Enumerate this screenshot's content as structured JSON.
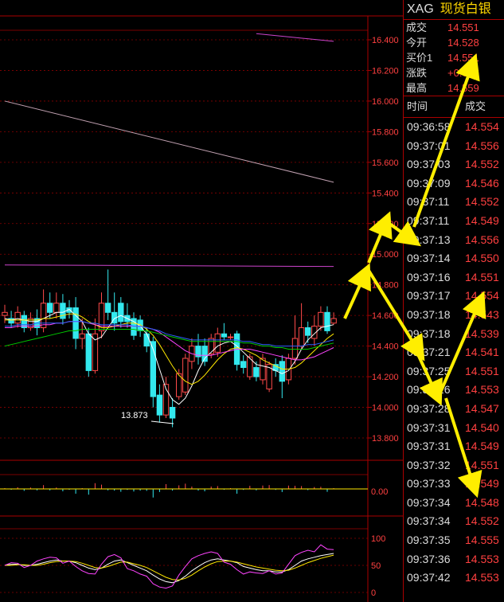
{
  "header": {
    "symbol": "XAG",
    "name": "现货白银"
  },
  "quote": [
    {
      "label": "成交",
      "value": "14.551"
    },
    {
      "label": "今开",
      "value": "14.528"
    },
    {
      "label": "买价1",
      "value": "14.551"
    },
    {
      "label": "涨跌",
      "value": "+0.086"
    },
    {
      "label": "最高",
      "value": "14.559"
    }
  ],
  "ticks_header": {
    "time": "时间",
    "price": "成交"
  },
  "ticks": [
    {
      "time": "09:36:58",
      "price": "14.554"
    },
    {
      "time": "09:37:01",
      "price": "14.556"
    },
    {
      "time": "09:37:03",
      "price": "14.552"
    },
    {
      "time": "09:37:09",
      "price": "14.546"
    },
    {
      "time": "09:37:11",
      "price": "14.552"
    },
    {
      "time": "09:37:11",
      "price": "14.549"
    },
    {
      "time": "09:37:13",
      "price": "14.556"
    },
    {
      "time": "09:37:14",
      "price": "14.550"
    },
    {
      "time": "09:37:16",
      "price": "14.551"
    },
    {
      "time": "09:37:17",
      "price": "14.554"
    },
    {
      "time": "09:37:18",
      "price": "14.543"
    },
    {
      "time": "09:37:18",
      "price": "14.539"
    },
    {
      "time": "09:37:21",
      "price": "14.541"
    },
    {
      "time": "09:37:25",
      "price": "14.551"
    },
    {
      "time": "09:37:26",
      "price": "14.553"
    },
    {
      "time": "09:37:28",
      "price": "14.547"
    },
    {
      "time": "09:37:31",
      "price": "14.540"
    },
    {
      "time": "09:37:31",
      "price": "14.549"
    },
    {
      "time": "09:37:32",
      "price": "14.551"
    },
    {
      "time": "09:37:33",
      "price": "14.549"
    },
    {
      "time": "09:37:34",
      "price": "14.548"
    },
    {
      "time": "09:37:34",
      "price": "14.552"
    },
    {
      "time": "09:37:35",
      "price": "14.555"
    },
    {
      "time": "09:37:36",
      "price": "14.553"
    },
    {
      "time": "09:37:42",
      "price": "14.553"
    }
  ],
  "chart_data": {
    "type": "candlestick",
    "price_axis": {
      "min": 13.8,
      "max": 16.4,
      "ticks": [
        "16.400",
        "16.200",
        "16.000",
        "15.800",
        "15.600",
        "15.400",
        "15.200",
        "15.000",
        "14.800",
        "14.600",
        "14.400",
        "14.200",
        "14.000",
        "13.800"
      ]
    },
    "low_annotation": "13.873",
    "candles": [
      {
        "o": 14.6,
        "c": 14.62,
        "h": 14.67,
        "l": 14.55
      },
      {
        "o": 14.58,
        "c": 14.55,
        "h": 14.63,
        "l": 14.52
      },
      {
        "o": 14.55,
        "c": 14.62,
        "h": 14.66,
        "l": 14.52
      },
      {
        "o": 14.6,
        "c": 14.52,
        "h": 14.63,
        "l": 14.49
      },
      {
        "o": 14.52,
        "c": 14.58,
        "h": 14.62,
        "l": 14.5
      },
      {
        "o": 14.58,
        "c": 14.52,
        "h": 14.64,
        "l": 14.47
      },
      {
        "o": 14.52,
        "c": 14.68,
        "h": 14.77,
        "l": 14.49
      },
      {
        "o": 14.68,
        "c": 14.62,
        "h": 14.75,
        "l": 14.58
      },
      {
        "o": 14.62,
        "c": 14.68,
        "h": 14.75,
        "l": 14.58
      },
      {
        "o": 14.68,
        "c": 14.58,
        "h": 14.74,
        "l": 14.54
      },
      {
        "o": 14.65,
        "c": 14.62,
        "h": 14.7,
        "l": 14.58
      },
      {
        "o": 14.65,
        "c": 14.45,
        "h": 14.72,
        "l": 14.38
      },
      {
        "o": 14.45,
        "c": 14.48,
        "h": 14.58,
        "l": 14.38
      },
      {
        "o": 14.48,
        "c": 14.24,
        "h": 14.52,
        "l": 14.2
      },
      {
        "o": 14.24,
        "c": 14.48,
        "h": 14.58,
        "l": 14.22
      },
      {
        "o": 14.5,
        "c": 14.68,
        "h": 14.75,
        "l": 14.45
      },
      {
        "o": 14.68,
        "c": 14.62,
        "h": 14.9,
        "l": 14.57
      },
      {
        "o": 14.62,
        "c": 14.55,
        "h": 14.75,
        "l": 14.5
      },
      {
        "o": 14.68,
        "c": 14.56,
        "h": 14.72,
        "l": 14.52
      },
      {
        "o": 14.6,
        "c": 14.56,
        "h": 14.68,
        "l": 14.52
      },
      {
        "o": 14.58,
        "c": 14.47,
        "h": 14.62,
        "l": 14.44
      },
      {
        "o": 14.57,
        "c": 14.5,
        "h": 14.6,
        "l": 14.46
      },
      {
        "o": 14.48,
        "c": 14.4,
        "h": 14.52,
        "l": 14.36
      },
      {
        "o": 14.43,
        "c": 14.07,
        "h": 14.46,
        "l": 14.0
      },
      {
        "o": 14.08,
        "c": 13.95,
        "h": 14.15,
        "l": 13.9
      },
      {
        "o": 13.95,
        "c": 14.15,
        "h": 14.2,
        "l": 13.93
      },
      {
        "o": 14.0,
        "c": 13.93,
        "h": 14.06,
        "l": 13.87
      },
      {
        "o": 14.07,
        "c": 14.22,
        "h": 14.25,
        "l": 14.05
      },
      {
        "o": 14.1,
        "c": 14.32,
        "h": 14.35,
        "l": 14.08
      },
      {
        "o": 14.3,
        "c": 14.4,
        "h": 14.45,
        "l": 14.25
      },
      {
        "o": 14.4,
        "c": 14.33,
        "h": 14.48,
        "l": 14.28
      },
      {
        "o": 14.4,
        "c": 14.3,
        "h": 14.45,
        "l": 14.27
      },
      {
        "o": 14.35,
        "c": 14.45,
        "h": 14.48,
        "l": 14.32
      },
      {
        "o": 14.36,
        "c": 14.48,
        "h": 14.52,
        "l": 14.33
      },
      {
        "o": 14.48,
        "c": 14.46,
        "h": 14.55,
        "l": 14.44
      },
      {
        "o": 14.46,
        "c": 14.46,
        "h": 14.48,
        "l": 14.44
      },
      {
        "o": 14.48,
        "c": 14.28,
        "h": 14.5,
        "l": 14.24
      },
      {
        "o": 14.3,
        "c": 14.26,
        "h": 14.34,
        "l": 14.22
      },
      {
        "o": 14.2,
        "c": 14.33,
        "h": 14.35,
        "l": 14.18
      },
      {
        "o": 14.26,
        "c": 14.2,
        "h": 14.3,
        "l": 14.17
      },
      {
        "o": 14.18,
        "c": 14.32,
        "h": 14.35,
        "l": 14.15
      },
      {
        "o": 14.12,
        "c": 14.28,
        "h": 14.3,
        "l": 14.1
      },
      {
        "o": 14.28,
        "c": 14.24,
        "h": 14.32,
        "l": 14.2
      },
      {
        "o": 14.3,
        "c": 14.17,
        "h": 14.34,
        "l": 14.06
      },
      {
        "o": 14.18,
        "c": 14.32,
        "h": 14.35,
        "l": 14.15
      },
      {
        "o": 14.32,
        "c": 14.45,
        "h": 14.6,
        "l": 14.28
      },
      {
        "o": 14.4,
        "c": 14.52,
        "h": 14.68,
        "l": 14.38
      },
      {
        "o": 14.52,
        "c": 14.47,
        "h": 14.56,
        "l": 14.42
      },
      {
        "o": 14.45,
        "c": 14.53,
        "h": 14.6,
        "l": 14.4
      },
      {
        "o": 14.53,
        "c": 14.62,
        "h": 14.66,
        "l": 14.5
      },
      {
        "o": 14.62,
        "c": 14.5,
        "h": 14.66,
        "l": 14.48
      },
      {
        "o": 14.55,
        "c": 14.58,
        "h": 14.62,
        "l": 14.54
      }
    ],
    "ma_lines": [
      {
        "color": "#ffffff",
        "values": [
          14.58,
          14.57,
          14.58,
          14.57,
          14.56,
          14.56,
          14.58,
          14.6,
          14.62,
          14.62,
          14.64,
          14.6,
          14.56,
          14.48,
          14.44,
          14.46,
          14.52,
          14.58,
          14.6,
          14.58,
          14.56,
          14.53,
          14.48,
          14.38,
          14.25,
          14.12,
          14.05,
          14.02,
          14.06,
          14.14,
          14.24,
          14.32,
          14.36,
          14.4,
          14.42,
          14.43,
          14.4,
          14.36,
          14.32,
          14.28,
          14.27,
          14.26,
          14.24,
          14.22,
          14.24,
          14.3,
          14.38,
          14.44,
          14.48,
          14.52,
          14.53,
          14.54
        ]
      },
      {
        "color": "#ffe800",
        "values": [
          14.57,
          14.57,
          14.57,
          14.57,
          14.57,
          14.57,
          14.58,
          14.58,
          14.59,
          14.6,
          14.61,
          14.61,
          14.59,
          14.56,
          14.54,
          14.52,
          14.52,
          14.53,
          14.54,
          14.55,
          14.55,
          14.54,
          14.51,
          14.47,
          14.41,
          14.34,
          14.27,
          14.21,
          14.17,
          14.15,
          14.17,
          14.21,
          14.26,
          14.31,
          14.35,
          14.38,
          14.39,
          14.38,
          14.36,
          14.34,
          14.31,
          14.29,
          14.27,
          14.25,
          14.25,
          14.26,
          14.29,
          14.33,
          14.37,
          14.41,
          14.45,
          14.48
        ]
      },
      {
        "color": "#ff44ff",
        "values": [
          14.52,
          14.52,
          14.53,
          14.53,
          14.53,
          14.53,
          14.54,
          14.54,
          14.55,
          14.55,
          14.56,
          14.56,
          14.56,
          14.55,
          14.54,
          14.53,
          14.53,
          14.53,
          14.53,
          14.53,
          14.53,
          14.53,
          14.52,
          14.51,
          14.49,
          14.46,
          14.43,
          14.4,
          14.37,
          14.35,
          14.34,
          14.34,
          14.34,
          14.35,
          14.36,
          14.37,
          14.38,
          14.38,
          14.38,
          14.37,
          14.36,
          14.35,
          14.34,
          14.33,
          14.32,
          14.31,
          14.31,
          14.32,
          14.33,
          14.35,
          14.37,
          14.39
        ]
      },
      {
        "color": "#00cc00",
        "values": [
          14.4,
          14.41,
          14.42,
          14.43,
          14.44,
          14.45,
          14.46,
          14.47,
          14.48,
          14.49,
          14.5,
          14.5,
          14.51,
          14.51,
          14.51,
          14.51,
          14.51,
          14.51,
          14.51,
          14.51,
          14.51,
          14.5,
          14.5,
          14.49,
          14.48,
          14.47,
          14.46,
          14.45,
          14.44,
          14.43,
          14.43,
          14.43,
          14.43,
          14.43,
          14.43,
          14.43,
          14.43,
          14.42,
          14.42,
          14.41,
          14.4,
          14.4,
          14.39,
          14.39,
          14.38,
          14.38,
          14.38,
          14.38,
          14.39,
          14.4,
          14.41,
          14.42
        ]
      },
      {
        "color": "#3060ff",
        "values": [
          14.53,
          14.53,
          14.54,
          14.54,
          14.54,
          14.55,
          14.55,
          14.55,
          14.55,
          14.55,
          14.56,
          14.56,
          14.56,
          14.55,
          14.55,
          14.54,
          14.54,
          14.54,
          14.54,
          14.54,
          14.53,
          14.53,
          14.52,
          14.51,
          14.5,
          14.48,
          14.47,
          14.46,
          14.45,
          14.44,
          14.44,
          14.44,
          14.44,
          14.44,
          14.44,
          14.44,
          14.44,
          14.43,
          14.43,
          14.42,
          14.41,
          14.41,
          14.4,
          14.4,
          14.4,
          14.4,
          14.4,
          14.41,
          14.41,
          14.42,
          14.43,
          14.44
        ]
      }
    ],
    "long_lines": [
      {
        "color": "#cc44cc",
        "from": {
          "i": 0,
          "v": 14.93
        },
        "to": {
          "i": 51,
          "v": 14.92
        }
      },
      {
        "color": "#cc44cc",
        "from": {
          "i": 39,
          "v": 16.44
        },
        "to": {
          "i": 51,
          "v": 16.39
        }
      },
      {
        "color": "#c0a0b0",
        "from": {
          "i": 0,
          "v": 16.0
        },
        "to": {
          "i": 51,
          "v": 15.47
        }
      }
    ],
    "macd_axis": {
      "label": "0.00"
    },
    "kdj_axis": {
      "ticks": [
        "100",
        "50",
        "0"
      ],
      "min": 0,
      "max": 100
    },
    "kdj_lines": [
      {
        "color": "#ffffff",
        "values": [
          50,
          52,
          52,
          50,
          50,
          52,
          55,
          58,
          60,
          58,
          58,
          55,
          50,
          45,
          42,
          45,
          52,
          58,
          60,
          55,
          50,
          45,
          40,
          32,
          25,
          20,
          18,
          22,
          30,
          40,
          48,
          55,
          60,
          62,
          60,
          58,
          55,
          48,
          45,
          42,
          40,
          40,
          38,
          38,
          42,
          50,
          58,
          62,
          65,
          68,
          70,
          72
        ]
      },
      {
        "color": "#ffe800",
        "values": [
          50,
          50,
          51,
          51,
          50,
          50,
          52,
          55,
          57,
          58,
          58,
          57,
          54,
          50,
          46,
          45,
          48,
          52,
          56,
          56,
          53,
          50,
          46,
          40,
          34,
          28,
          24,
          23,
          26,
          32,
          40,
          47,
          53,
          57,
          58,
          58,
          56,
          53,
          50,
          47,
          45,
          43,
          41,
          40,
          41,
          45,
          50,
          55,
          59,
          63,
          66,
          69
        ]
      },
      {
        "color": "#ff44ff",
        "values": [
          50,
          55,
          54,
          46,
          50,
          58,
          62,
          65,
          64,
          54,
          58,
          48,
          40,
          35,
          34,
          52,
          66,
          70,
          64,
          44,
          40,
          34,
          30,
          16,
          10,
          8,
          12,
          32,
          48,
          62,
          68,
          72,
          75,
          72,
          56,
          52,
          42,
          34,
          38,
          36,
          35,
          40,
          34,
          36,
          52,
          68,
          74,
          78,
          75,
          88,
          80,
          79
        ]
      }
    ]
  }
}
